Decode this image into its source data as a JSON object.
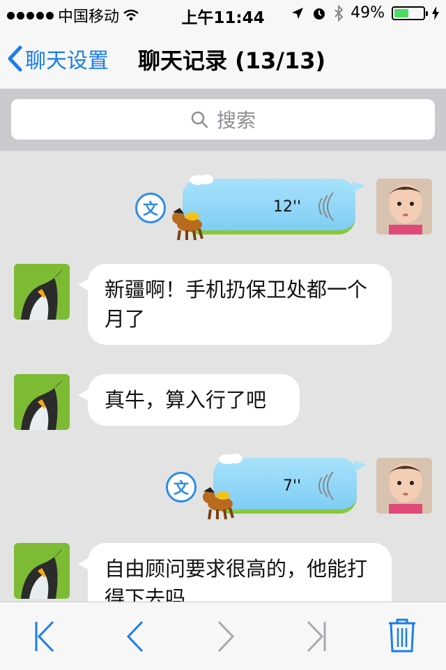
{
  "status_bar": {
    "carrier": "中国移动",
    "time": "上午11:44",
    "battery": "49%",
    "battery_level": 0.49
  },
  "nav": {
    "back_label": "聊天设置",
    "title": "聊天记录 (13/13)"
  },
  "search": {
    "placeholder": "搜索"
  },
  "messages": {
    "voice1": {
      "duration": "12''"
    },
    "text1": "新疆啊！手机扔保卫处都一个月了",
    "text2": "真牛，算入行了吧",
    "voice2": {
      "duration": "7''"
    },
    "text3": "自由顾问要求很高的，他能打得下去吗"
  },
  "translate_icon_label": "文",
  "icons": {
    "back": "chevron-left-icon",
    "search": "magnifier-icon",
    "first": "first-page-icon",
    "prev": "previous-page-icon",
    "next": "next-page-icon",
    "last": "last-page-icon",
    "delete": "trash-icon"
  },
  "colors": {
    "accent": "#1a7cf0",
    "voice_bubble": "#8fd6f7",
    "voice_bubble_border": "#8ac83b"
  }
}
